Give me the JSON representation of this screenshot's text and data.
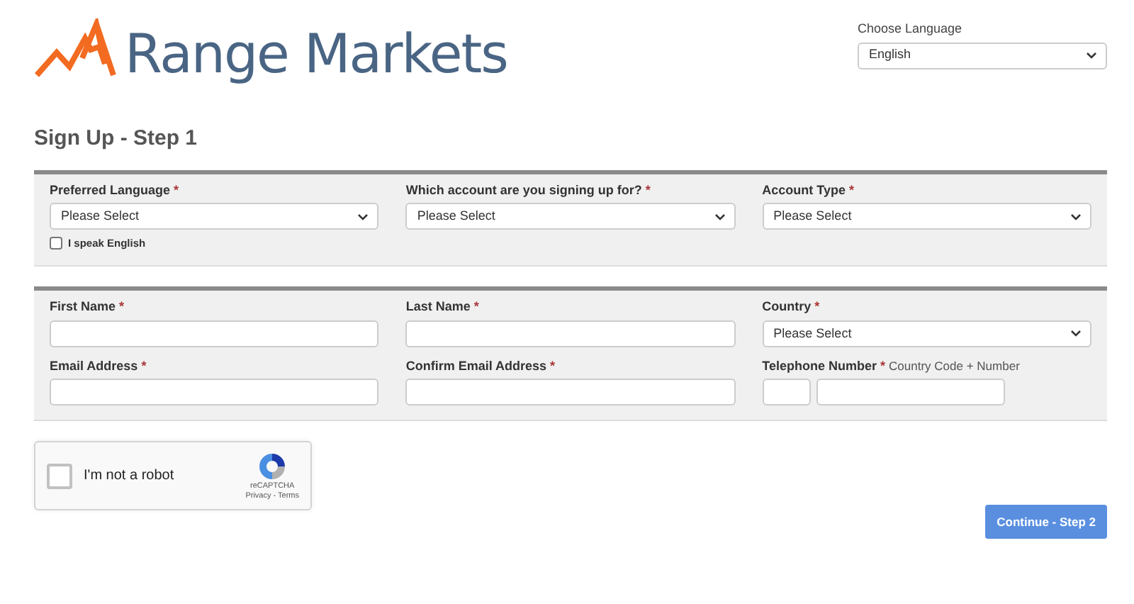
{
  "brand": {
    "name": "Range Markets"
  },
  "language_picker": {
    "label": "Choose Language",
    "value": "English"
  },
  "heading": "Sign Up - Step 1",
  "sections": [
    {
      "fields": [
        {
          "kind": "select",
          "label": "Preferred Language",
          "required_mark": "*",
          "value": "Please Select",
          "checkbox": {
            "label": "I speak English",
            "checked": false
          }
        },
        {
          "kind": "select",
          "label": "Which account are you signing up for?",
          "required_mark": "*",
          "value": "Please Select"
        },
        {
          "kind": "select",
          "label": "Account Type",
          "required_mark": "*",
          "value": "Please Select"
        }
      ]
    },
    {
      "fields": [
        {
          "kind": "text",
          "label": "First Name",
          "required_mark": "*"
        },
        {
          "kind": "text",
          "label": "Last Name",
          "required_mark": "*"
        },
        {
          "kind": "select",
          "label": "Country",
          "required_mark": "*",
          "value": "Please Select"
        },
        {
          "kind": "text",
          "label": "Email Address",
          "required_mark": "*"
        },
        {
          "kind": "text",
          "label": "Confirm Email Address",
          "required_mark": "*"
        },
        {
          "kind": "phone",
          "label": "Telephone Number",
          "required_mark": "*",
          "hint": "Country Code + Number"
        }
      ]
    }
  ],
  "captcha": {
    "label": "I'm not a robot",
    "checked": false,
    "brand": "reCAPTCHA",
    "links": "Privacy - Terms"
  },
  "submit": {
    "label": "Continue - Step 2"
  }
}
